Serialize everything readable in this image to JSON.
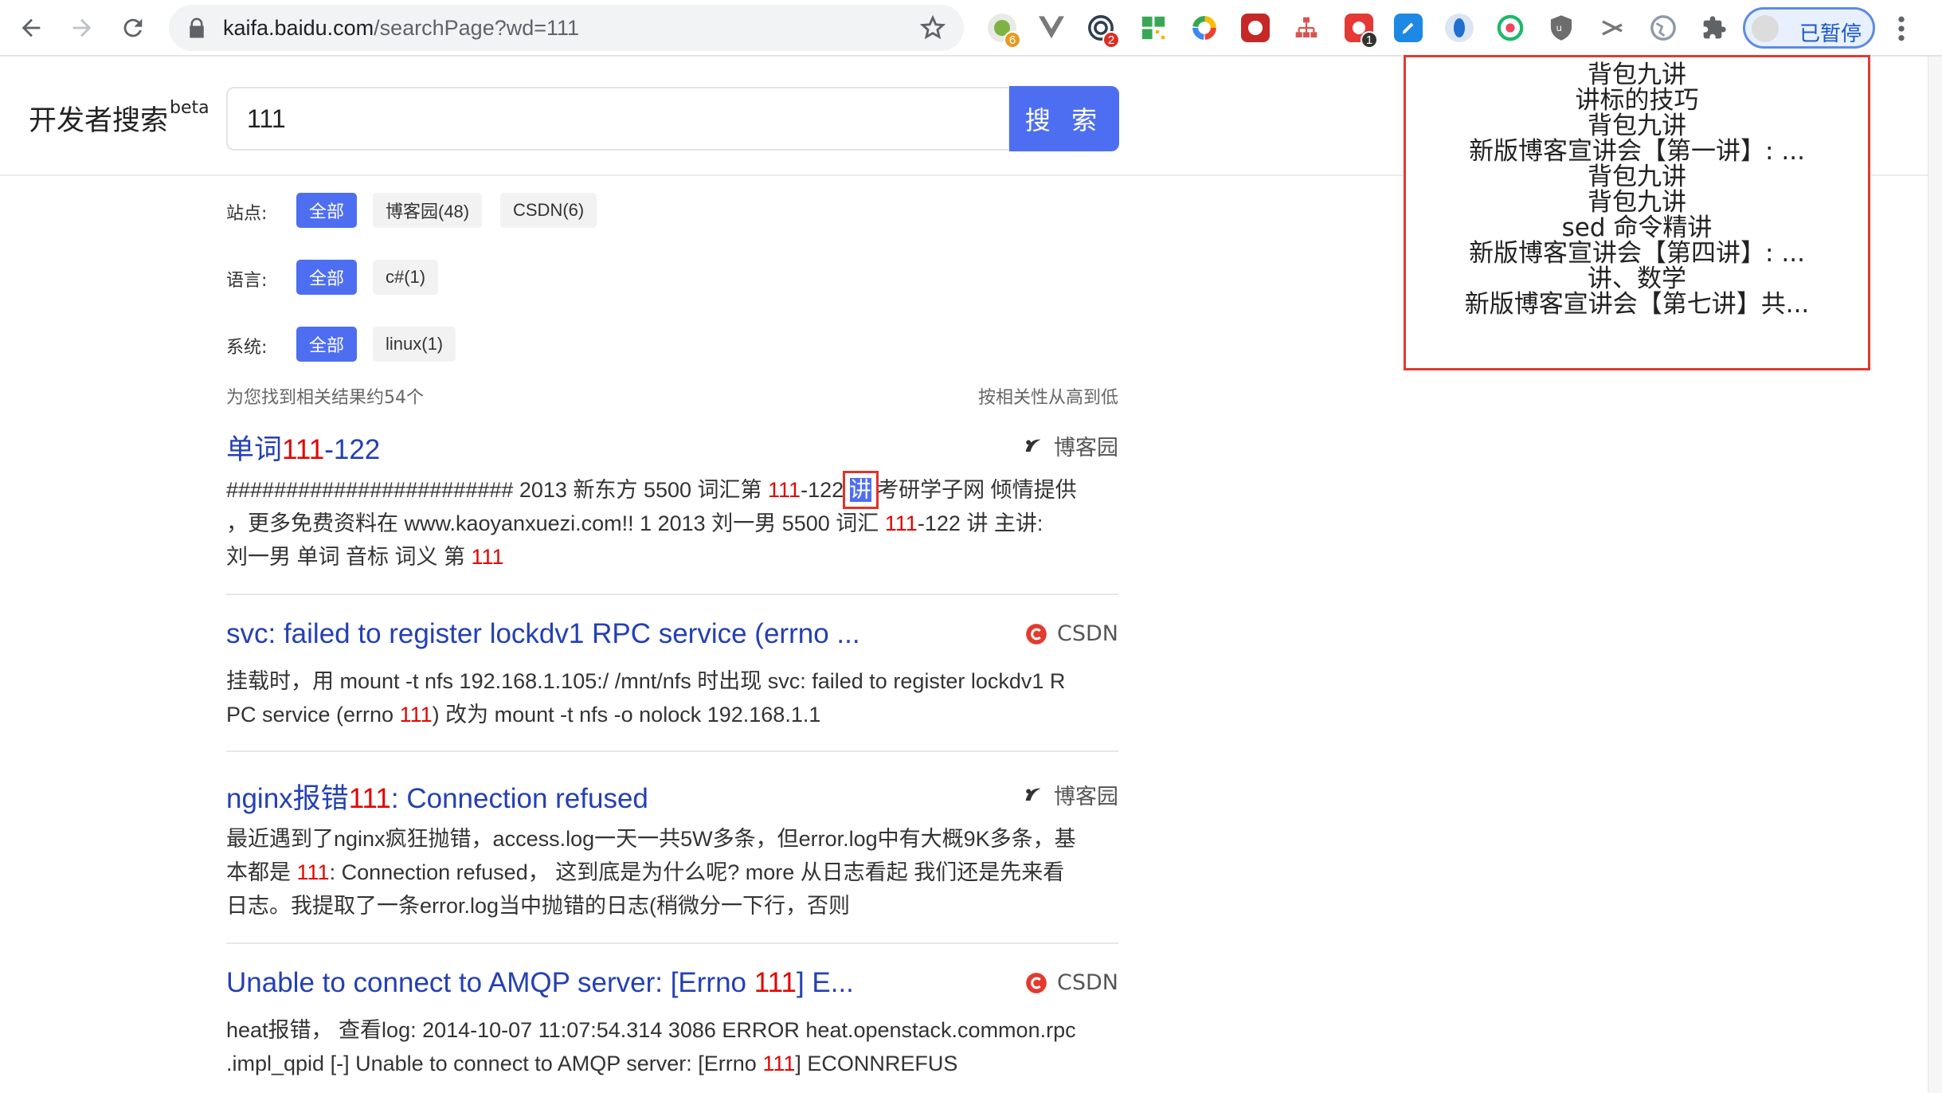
{
  "browser": {
    "url_host": "kaifa.baidu.com",
    "url_path": "/searchPage?wd=111",
    "extension_badges": [
      "6",
      "2",
      "1"
    ],
    "profile_label": "已暂停"
  },
  "header": {
    "site_title": "开发者搜索",
    "site_title_suffix": "beta",
    "search_value": "111",
    "search_button": "搜 索"
  },
  "filters": {
    "site": {
      "label": "站点:",
      "chips": [
        "全部",
        "博客园(48)",
        "CSDN(6)"
      ]
    },
    "language": {
      "label": "语言:",
      "chips": [
        "全部",
        "c#(1)"
      ]
    },
    "system": {
      "label": "系统:",
      "chips": [
        "全部",
        "linux(1)"
      ]
    }
  },
  "summary": {
    "count_text": "为您找到相关结果约54个",
    "sort_text": "按相关性从高到低"
  },
  "results": [
    {
      "title_pre": "单词",
      "title_hl": "111",
      "title_post": "-122",
      "source": "博客园",
      "lines": [
        [
          "######################## 2013 新东方 5500 词汇第 ",
          "111",
          "-122 ",
          "讲",
          " 考研学子网 倾情提供"
        ],
        [
          "，更多免费资料在 www.kaoyanxuezi.com!! 1 2013 刘一男 5500 词汇 ",
          "111",
          "-122 讲 主讲:"
        ],
        [
          "刘一男 单词 音标 词义 第 ",
          "111"
        ]
      ]
    },
    {
      "title_pre": "svc: failed to register lockdv1 RPC service (errno ...",
      "source": "CSDN",
      "lines": [
        [
          "挂载时，用 mount -t nfs 192.168.1.105:/ /mnt/nfs 时出现 svc: failed to register lockdv1 R"
        ],
        [
          "PC service (errno ",
          "111",
          ") 改为 mount -t nfs -o nolock 192.168.1.1"
        ]
      ]
    },
    {
      "title_pre": "nginx报错",
      "title_hl": "111",
      "title_post": ": Connection refused",
      "source": "博客园",
      "lines": [
        [
          "最近遇到了nginx疯狂抛错，access.log一天一共5W多条，但error.log中有大概9K多条，基"
        ],
        [
          "本都是 ",
          "111",
          ": Connection refused， 这到底是为什么呢?   more 从日志看起 我们还是先来看"
        ],
        [
          "日志。我提取了一条error.log当中抛错的日志(稍微分一下行，否则"
        ]
      ]
    },
    {
      "title_pre": "Unable to connect to AMQP server: [Errno ",
      "title_hl": "111",
      "title_post": "] E...",
      "source": "CSDN",
      "lines": [
        [
          "heat报错， 查看log: 2014-10-07 11:07:54.314 3086 ERROR heat.openstack.common.rpc"
        ],
        [
          ".impl_qpid [-] Unable to connect to AMQP server: [Errno ",
          "111",
          "] ECONNREFUS"
        ]
      ]
    }
  ],
  "annotation_items": [
    "背包九讲",
    "讲标的技巧",
    "背包九讲",
    "新版博客宣讲会【第一讲】: ...",
    "背包九讲",
    "背包九讲",
    "sed 命令精讲",
    "新版博客宣讲会【第四讲】: ...",
    "讲、数学",
    "新版博客宣讲会【第七讲】共..."
  ],
  "colors": {
    "accent": "#4e6ef2",
    "link": "#2440b3",
    "highlight": "#e10601",
    "annotation_border": "#e23a30"
  }
}
